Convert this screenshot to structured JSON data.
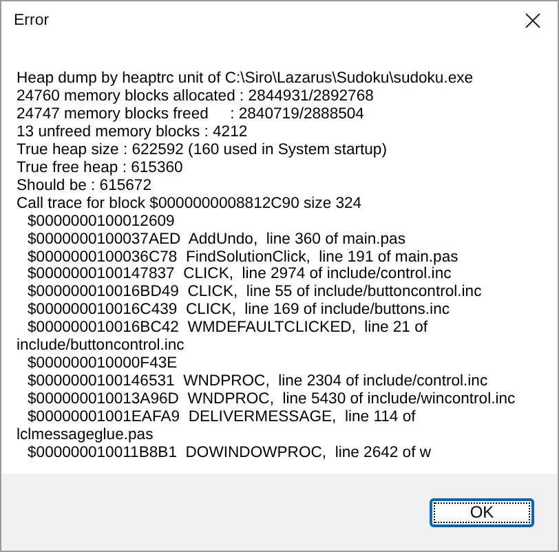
{
  "window": {
    "title": "Error"
  },
  "message": [
    {
      "text": "Heap dump by heaptrc unit of C:\\Siro\\Lazarus\\Sudoku\\sudoku.exe",
      "indented": false
    },
    {
      "text": "24760 memory blocks allocated : 2844931/2892768",
      "indented": false
    },
    {
      "text": "24747 memory blocks freed     : 2840719/2888504",
      "indented": false
    },
    {
      "text": "13 unfreed memory blocks : 4212",
      "indented": false
    },
    {
      "text": "True heap size : 622592 (160 used in System startup)",
      "indented": false
    },
    {
      "text": "True free heap : 615360",
      "indented": false
    },
    {
      "text": "Should be : 615672",
      "indented": false
    },
    {
      "text": "Call trace for block $0000000008812C90 size 324",
      "indented": false
    },
    {
      "text": "$0000000100012609",
      "indented": true
    },
    {
      "text": "$0000000100037AED  AddUndo,  line 360 of main.pas",
      "indented": true
    },
    {
      "text": "$0000000100036C78  FindSolutionClick,  line 191 of main.pas",
      "indented": true
    },
    {
      "text": "$0000000100147837  CLICK,  line 2974 of include/control.inc",
      "indented": true
    },
    {
      "text": "$000000010016BD49  CLICK,  line 55 of include/buttoncontrol.inc",
      "indented": true
    },
    {
      "text": "$000000010016C439  CLICK,  line 169 of include/buttons.inc",
      "indented": true
    },
    {
      "text": "$000000010016BC42  WMDEFAULTCLICKED,  line 21 of include/buttoncontrol.inc",
      "indented": true
    },
    {
      "text": "$000000010000F43E",
      "indented": true
    },
    {
      "text": "$0000000100146531  WNDPROC,  line 2304 of include/control.inc",
      "indented": true
    },
    {
      "text": "$000000010013A96D  WNDPROC,  line 5430 of include/wincontrol.inc",
      "indented": true
    },
    {
      "text": "$00000001001EAFA9  DELIVERMESSAGE,  line 114 of lclmessageglue.pas",
      "indented": true
    },
    {
      "text": "$000000010011B8B1  DOWINDOWPROC,  line 2642 of w",
      "indented": true
    }
  ],
  "buttons": [
    {
      "label": "OK",
      "default": true
    }
  ]
}
